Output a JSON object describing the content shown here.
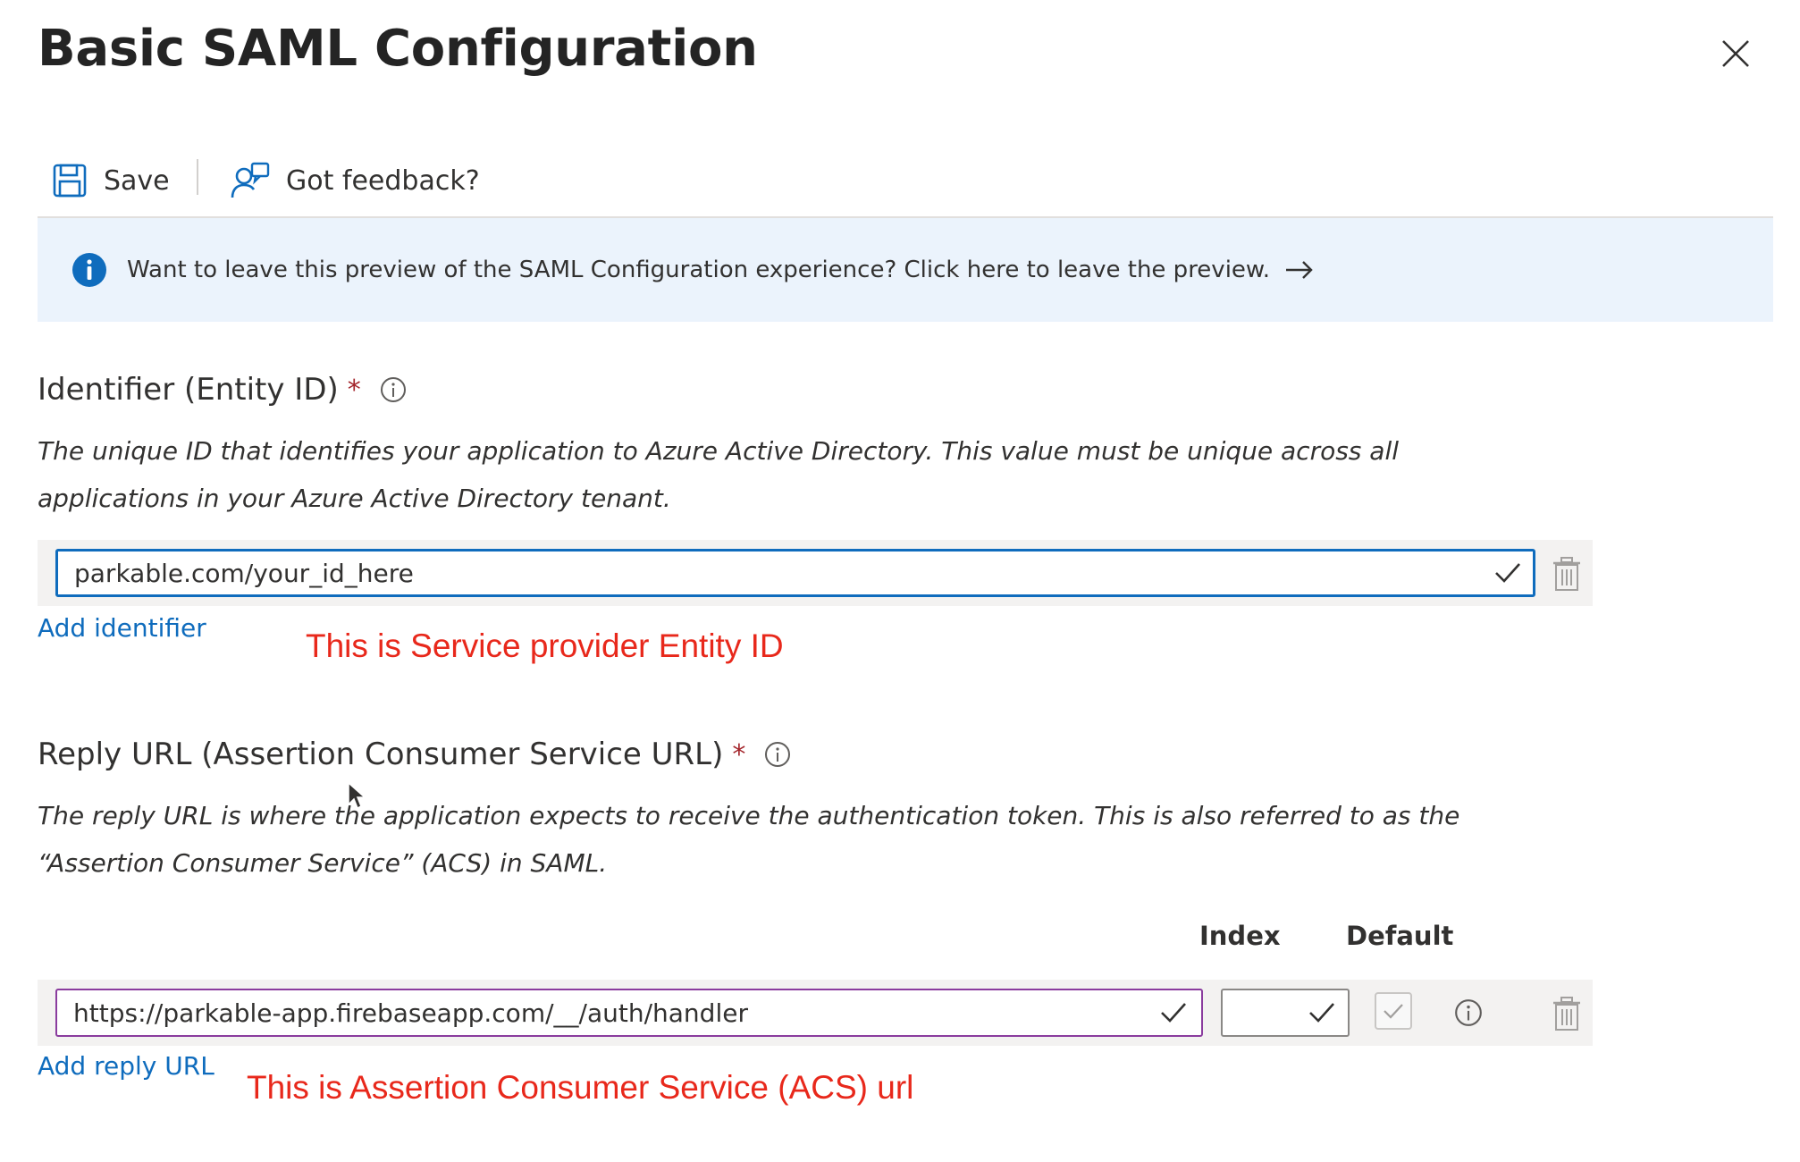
{
  "panel": {
    "title": "Basic SAML Configuration",
    "close_icon": "close-icon"
  },
  "toolbar": {
    "save_label": "Save",
    "feedback_label": "Got feedback?"
  },
  "banner": {
    "text": "Want to leave this preview of the SAML Configuration experience? Click here to leave the preview."
  },
  "identifier": {
    "label": "Identifier (Entity ID)",
    "required_mark": "*",
    "description": "The unique ID that identifies your application to Azure Active Directory. This value must be unique across all applications in your Azure Active Directory tenant.",
    "value": "parkable.com/your_id_here",
    "add_link": "Add identifier",
    "annotation": "This is Service provider Entity ID"
  },
  "reply_url": {
    "label": "Reply URL (Assertion Consumer Service URL)",
    "required_mark": "*",
    "description": "The reply URL is where the application expects to receive the authentication token. This is also referred to as the “Assertion Consumer Service” (ACS) in SAML.",
    "index_header": "Index",
    "default_header": "Default",
    "value": "https://parkable-app.firebaseapp.com/__/auth/handler",
    "index_value": "",
    "add_link": "Add reply URL",
    "annotation": "This is Assertion Consumer Service (ACS) url"
  },
  "colors": {
    "accent": "#0f6cbd",
    "banner_bg": "#ebf3fc",
    "annotation": "#e8281b",
    "required": "#a4262c",
    "focused_border": "#0f6cbd",
    "reply_border": "#8a3c9e"
  }
}
